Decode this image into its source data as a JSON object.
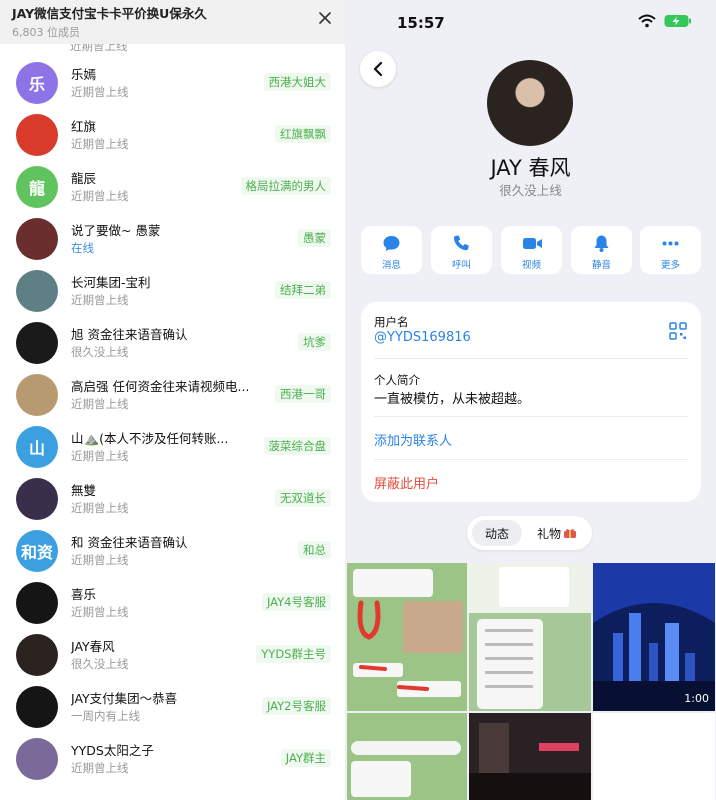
{
  "group": {
    "title": "JAY微信支付宝卡卡平价换U保永久",
    "member_count": "6,803 位成员",
    "partial_status": "近期曾上线"
  },
  "members": [
    {
      "name": "乐嫣",
      "status": "近期曾上线",
      "tag": "西港大姐大",
      "avatar_text": "乐",
      "avatar_color": "#8e73e6"
    },
    {
      "name": "红旗",
      "status": "近期曾上线",
      "tag": "红旗飘飘",
      "avatar_text": "",
      "avatar_color": "#d83a2c"
    },
    {
      "name": "龍辰",
      "status": "近期曾上线",
      "tag": "格局拉满的男人",
      "avatar_text": "龍",
      "avatar_color": "#5fc45f"
    },
    {
      "name": "说了要做~ 愚蒙",
      "status": "在线",
      "tag": "愚蒙",
      "avatar_text": "",
      "avatar_color": "#6b2e2e"
    },
    {
      "name": "长河集团-宝利",
      "status": "近期曾上线",
      "tag": "结拜二弟",
      "avatar_text": "",
      "avatar_color": "#5e7f86"
    },
    {
      "name": "旭 资金往来语音确认",
      "status": "很久没上线",
      "tag": "坑爹",
      "avatar_text": "",
      "avatar_color": "#1a1a1a"
    },
    {
      "name": "高启强 任何资金往来请视频电...",
      "status": "近期曾上线",
      "tag": "西港一哥",
      "avatar_text": "",
      "avatar_color": "#b79a70"
    },
    {
      "name": "山⛰️(本人不涉及任何转账...",
      "status": "近期曾上线",
      "tag": "菠菜综合盘",
      "avatar_text": "山",
      "avatar_color": "#3aa0e0"
    },
    {
      "name": "無雙",
      "status": "近期曾上线",
      "tag": "无双道长",
      "avatar_text": "",
      "avatar_color": "#3a2f4a"
    },
    {
      "name": "和 资金往来语音确认",
      "status": "近期曾上线",
      "tag": "和总",
      "avatar_text": "和资",
      "avatar_color": "#3aa0e0"
    },
    {
      "name": "喜乐",
      "status": "近期曾上线",
      "tag": "JAY4号客服",
      "avatar_text": "",
      "avatar_color": "#151515"
    },
    {
      "name": "JAY春风",
      "status": "很久没上线",
      "tag": "YYDS群主号",
      "avatar_text": "",
      "avatar_color": "#2b2320"
    },
    {
      "name": "JAY支付集团～恭喜",
      "status": "一周内有上线",
      "tag": "JAY2号客服",
      "avatar_text": "",
      "avatar_color": "#151515"
    },
    {
      "name": "YYDS太阳之子",
      "status": "近期曾上线",
      "tag": "JAY群主",
      "avatar_text": "",
      "avatar_color": "#7a6a9a"
    }
  ],
  "status_bar": {
    "time": "15:57"
  },
  "profile": {
    "name": "JAY 春风",
    "status": "很久没上线",
    "actions": [
      {
        "label": "消息",
        "icon": "message-icon"
      },
      {
        "label": "呼叫",
        "icon": "phone-icon"
      },
      {
        "label": "视频",
        "icon": "video-icon"
      },
      {
        "label": "静音",
        "icon": "bell-icon"
      },
      {
        "label": "更多",
        "icon": "more-icon"
      }
    ],
    "username_label": "用户名",
    "username": "@YYDS169816",
    "bio_label": "个人简介",
    "bio": "一直被模仿，从未被超越。",
    "add_contact": "添加为联系人",
    "block_user": "屏蔽此用户",
    "tabs": [
      "动态",
      "礼物"
    ],
    "video_duration": "1:00"
  },
  "colors": {
    "accent": "#2a83e6",
    "danger": "#e74c3c",
    "tag_green": "#4caf50"
  }
}
